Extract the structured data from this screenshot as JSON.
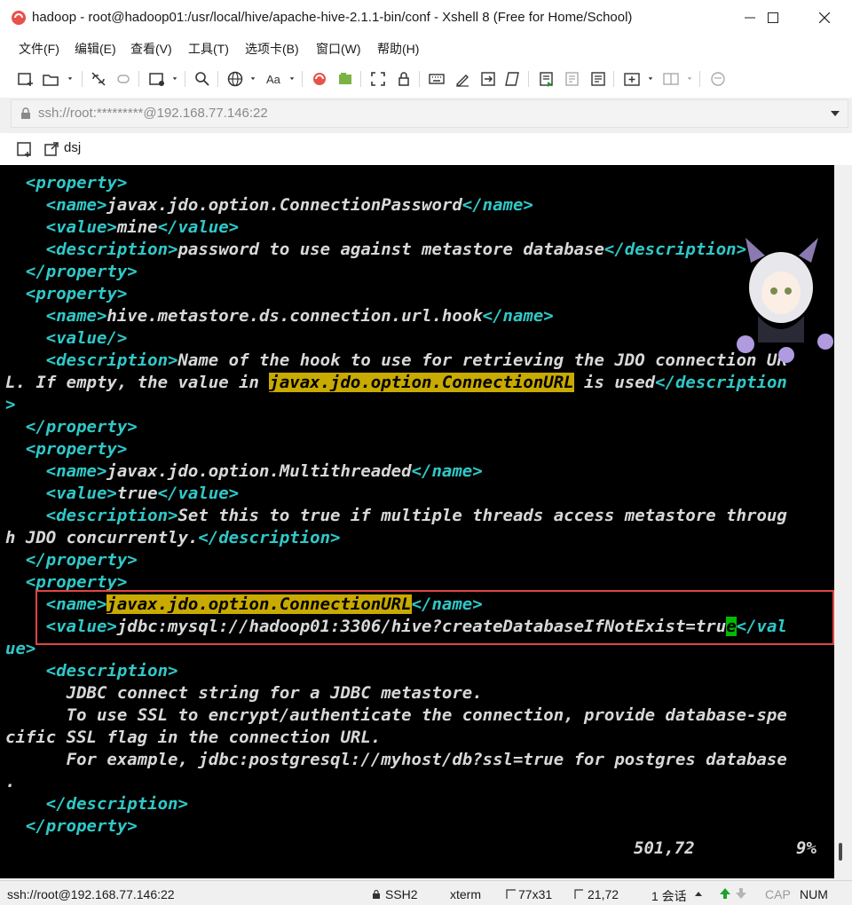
{
  "window": {
    "title": "hadoop - root@hadoop01:/usr/local/hive/apache-hive-2.1.1-bin/conf - Xshell 8 (Free for Home/School)"
  },
  "menu": {
    "items": [
      "文件(F)",
      "编辑(E)",
      "查看(V)",
      "工具(T)",
      "选项卡(B)",
      "窗口(W)",
      "帮助(H)"
    ]
  },
  "address": {
    "text": "ssh://root:*********@192.168.77.146:22"
  },
  "tabs": {
    "active_label": "dsj"
  },
  "terminal": {
    "lines": [
      [
        {
          "t": "  <property>",
          "c": "tl"
        }
      ],
      [
        {
          "t": "    <name>",
          "c": "tl"
        },
        {
          "t": "javax.jdo.option.ConnectionPassword",
          "c": "tx"
        },
        {
          "t": "</name>",
          "c": "tl"
        }
      ],
      [
        {
          "t": "    <value>",
          "c": "tl"
        },
        {
          "t": "mine",
          "c": "tx"
        },
        {
          "t": "</value>",
          "c": "tl"
        }
      ],
      [
        {
          "t": "    <description>",
          "c": "tl"
        },
        {
          "t": "password to use against metastore database",
          "c": "tx"
        },
        {
          "t": "</description>",
          "c": "tl"
        }
      ],
      [
        {
          "t": "  </property>",
          "c": "tl"
        }
      ],
      [
        {
          "t": "  <property>",
          "c": "tl"
        }
      ],
      [
        {
          "t": "    <name>",
          "c": "tl"
        },
        {
          "t": "hive.metastore.ds.connection.url.hook",
          "c": "tx"
        },
        {
          "t": "</name>",
          "c": "tl"
        }
      ],
      [
        {
          "t": "    <value/>",
          "c": "tl"
        }
      ],
      [
        {
          "t": "    <description>",
          "c": "tl"
        },
        {
          "t": "Name of the hook to use for retrieving the JDO connection UR",
          "c": "tx"
        }
      ],
      [
        {
          "t": "L. If empty, the value in ",
          "c": "tx"
        },
        {
          "t": "javax.jdo.option.ConnectionURL",
          "c": "hl"
        },
        {
          "t": " is used",
          "c": "tx"
        },
        {
          "t": "</description",
          "c": "tl"
        }
      ],
      [
        {
          "t": ">",
          "c": "tl"
        }
      ],
      [
        {
          "t": "  </property>",
          "c": "tl"
        }
      ],
      [
        {
          "t": "  <property>",
          "c": "tl"
        }
      ],
      [
        {
          "t": "    <name>",
          "c": "tl"
        },
        {
          "t": "javax.jdo.option.Multithreaded",
          "c": "tx"
        },
        {
          "t": "</name>",
          "c": "tl"
        }
      ],
      [
        {
          "t": "    <value>",
          "c": "tl"
        },
        {
          "t": "true",
          "c": "tx"
        },
        {
          "t": "</value>",
          "c": "tl"
        }
      ],
      [
        {
          "t": "    <description>",
          "c": "tl"
        },
        {
          "t": "Set this to true if multiple threads access metastore throug",
          "c": "tx"
        }
      ],
      [
        {
          "t": "h JDO concurrently.",
          "c": "tx"
        },
        {
          "t": "</description>",
          "c": "tl"
        }
      ],
      [
        {
          "t": "  </property>",
          "c": "tl"
        }
      ],
      [
        {
          "t": "  <property>",
          "c": "tl"
        }
      ],
      [
        {
          "t": "    <name>",
          "c": "tl"
        },
        {
          "t": "javax.jdo.option.ConnectionURL",
          "c": "hl"
        },
        {
          "t": "</name>",
          "c": "tl"
        }
      ],
      [
        {
          "t": "    <value>",
          "c": "tl"
        },
        {
          "t": "jdbc:mysql://hadoop01:3306/hive?createDatabaseIfNotExist=tru",
          "c": "tx"
        },
        {
          "t": "e",
          "c": "cur"
        },
        {
          "t": "</val",
          "c": "tl"
        }
      ],
      [
        {
          "t": "ue>",
          "c": "tl"
        }
      ],
      [
        {
          "t": "    <description>",
          "c": "tl"
        }
      ],
      [
        {
          "t": "      JDBC connect string for a JDBC metastore.",
          "c": "tx"
        }
      ],
      [
        {
          "t": "      To use SSL to encrypt/authenticate the connection, provide database-spe",
          "c": "tx"
        }
      ],
      [
        {
          "t": "cific SSL flag in the connection URL.",
          "c": "tx"
        }
      ],
      [
        {
          "t": "      For example, jdbc:postgresql://myhost/db?ssl=true for postgres database",
          "c": "tx"
        }
      ],
      [
        {
          "t": ".",
          "c": "tx"
        }
      ],
      [
        {
          "t": "    </description>",
          "c": "tl"
        }
      ],
      [
        {
          "t": "  </property>",
          "c": "tl"
        }
      ]
    ],
    "status_position": "501,72",
    "status_percent": "9%"
  },
  "statusbar": {
    "connection": "ssh://root@192.168.77.146:22",
    "protocol": "SSH2",
    "term": "xterm",
    "size": "77x31",
    "cursor": "21,72",
    "sessions": "1 会话",
    "cap": "CAP",
    "num": "NUM"
  },
  "colors": {
    "terminal_bg": "#000000",
    "tag": "#30c8c8",
    "text": "#d8d8d8",
    "search_highlight": "#c8aa00",
    "cursor": "#00bb00",
    "annotation_box": "#e04545"
  },
  "icons": [
    "xshell-logo-icon",
    "minimize-icon",
    "maximize-icon",
    "close-icon",
    "new-session-icon",
    "open-folder-icon",
    "disconnect-icon",
    "reconnect-icon",
    "new-window-icon",
    "search-icon",
    "globe-icon",
    "font-icon",
    "xftp-icon",
    "xftp-transfer-icon",
    "fullscreen-icon",
    "lock-icon",
    "keyboard-icon",
    "highlight-icon",
    "send-icon",
    "script-icon",
    "log-icon",
    "compose-icon",
    "tab-layout-icon",
    "chat-icon",
    "address-lock-icon",
    "dropdown-icon",
    "session-manager-icon",
    "tab-pin-icon",
    "up-arrow-icon",
    "down-arrow-icon"
  ]
}
